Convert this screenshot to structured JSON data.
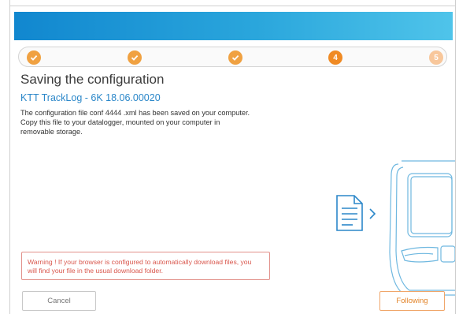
{
  "stepper": {
    "steps": [
      {
        "state": "done",
        "label": ""
      },
      {
        "state": "done",
        "label": ""
      },
      {
        "state": "done",
        "label": ""
      },
      {
        "state": "current",
        "label": "4"
      },
      {
        "state": "todo",
        "label": "5"
      }
    ]
  },
  "page": {
    "title": "Saving the configuration",
    "subtitle": "KTT TrackLog - 6K 18.06.00020",
    "body_lines": [
      "The configuration file conf 4444 .xml has been saved on your computer.",
      "Copy this file to your datalogger, mounted on your computer in",
      "removable storage."
    ]
  },
  "warning": {
    "lines": [
      "Warning ! If your browser is configured to automatically download files, you",
      "will find your file in the usual download folder."
    ]
  },
  "buttons": {
    "cancel": "Cancel",
    "next": "Following"
  },
  "colors": {
    "accent": "#2b87c9",
    "step_done": "#f0a141",
    "warning": "#d9574d",
    "header": "#1187cf"
  }
}
